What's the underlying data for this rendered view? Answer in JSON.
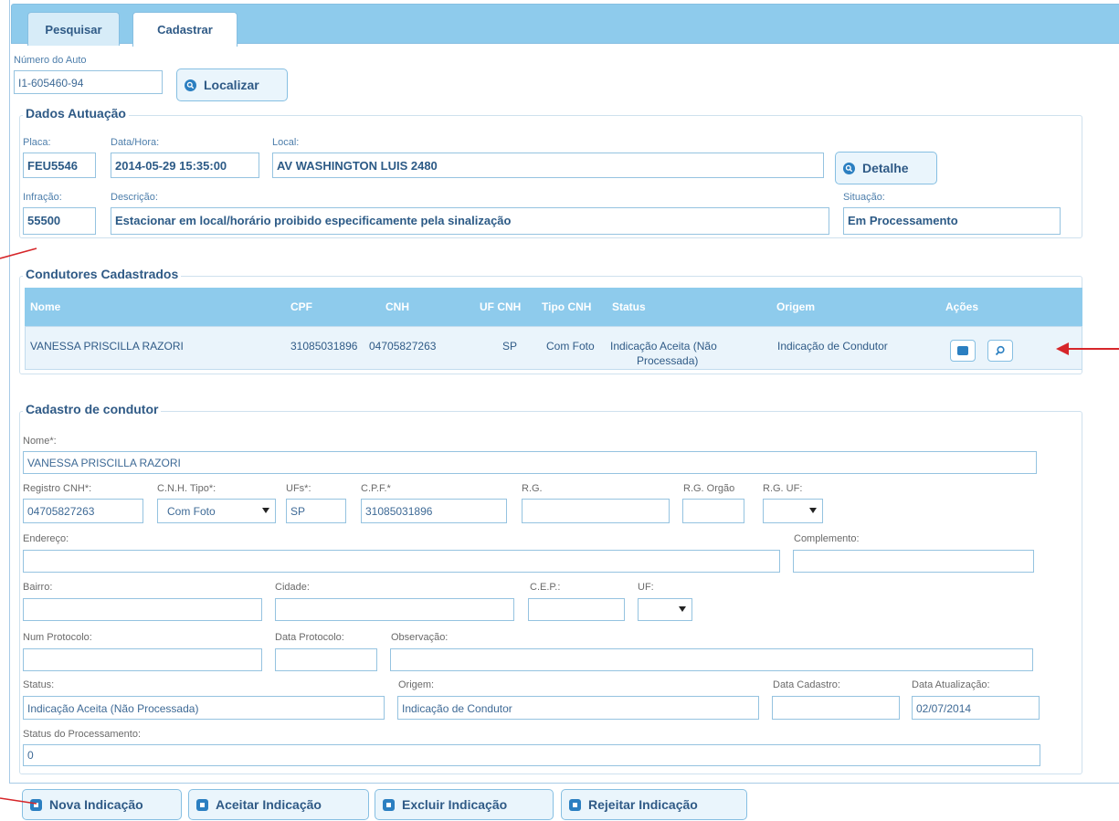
{
  "tabs": {
    "search": "Pesquisar",
    "register": "Cadastrar"
  },
  "auto": {
    "label": "Número do Auto",
    "value": "I1-605460-94",
    "locate_button": "Localizar"
  },
  "dados": {
    "legend": "Dados Autuação",
    "placa_label": "Placa:",
    "placa": "FEU5546",
    "datahora_label": "Data/Hora:",
    "datahora": "2014-05-29 15:35:00",
    "local_label": "Local:",
    "local": "AV WASHINGTON LUIS 2480",
    "detail_button": "Detalhe",
    "infracao_label": "Infração:",
    "infracao": "55500",
    "descricao_label": "Descrição:",
    "descricao": "Estacionar em local/horário proibido especificamente pela sinalização",
    "situacao_label": "Situação:",
    "situacao": "Em Processamento"
  },
  "condutores": {
    "legend": "Condutores Cadastrados",
    "columns": {
      "nome": "Nome",
      "cpf": "CPF",
      "cnh": "CNH",
      "uf_cnh": "UF CNH",
      "tipo_cnh": "Tipo CNH",
      "status": "Status",
      "origem": "Origem",
      "acoes": "Ações"
    },
    "row": {
      "nome": "VANESSA PRISCILLA RAZORI",
      "cpf": "31085031896",
      "cnh": "04705827263",
      "uf_cnh": "SP",
      "tipo_cnh": "Com Foto",
      "status_line1": "Indicação Aceita (Não",
      "status_line2": "Processada)",
      "origem": "Indicação de Condutor"
    }
  },
  "cadastro": {
    "legend": "Cadastro de condutor",
    "nome_label": "Nome*:",
    "nome": "VANESSA PRISCILLA RAZORI",
    "cnh_label": "Registro CNH*:",
    "cnh": "04705827263",
    "cnh_tipo_label": "C.N.H. Tipo*:",
    "cnh_tipo": "Com Foto",
    "ufs_label": "UFs*:",
    "ufs": "SP",
    "cpf_label": "C.P.F.*",
    "cpf": "31085031896",
    "rg_label": "R.G.",
    "rg": "",
    "rg_orgao_label": "R.G. Orgão",
    "rg_orgao": "",
    "rg_uf_label": "R.G. UF:",
    "rg_uf": "",
    "endereco_label": "Endereço:",
    "endereco": "",
    "complemento_label": "Complemento:",
    "complemento": "",
    "bairro_label": "Bairro:",
    "bairro": "",
    "cidade_label": "Cidade:",
    "cidade": "",
    "cep_label": "C.E.P.:",
    "cep": "",
    "uf_label": "UF:",
    "uf": "",
    "protocolo_label": "Num Protocolo:",
    "protocolo": "",
    "data_protocolo_label": "Data Protocolo:",
    "data_protocolo": "",
    "observacao_label": "Observação:",
    "observacao": "",
    "status_label": "Status:",
    "status": "Indicação Aceita (Não Processada)",
    "origem_label": "Origem:",
    "origem": "Indicação de Condutor",
    "data_cadastro_label": "Data Cadastro:",
    "data_cadastro": "",
    "data_atualizacao_label": "Data Atualização:",
    "data_atualizacao": "02/07/2014",
    "status_proc_label": "Status do Processamento:",
    "status_proc": "0"
  },
  "actions": {
    "nova": "Nova Indicação",
    "aceitar": "Aceitar Indicação",
    "excluir": "Excluir Indicação",
    "rejeitar": "Rejeitar Indicação"
  },
  "colors": {
    "accent": "#8ecbec",
    "text": "#2f5a86",
    "annotation": "#d6262a"
  }
}
